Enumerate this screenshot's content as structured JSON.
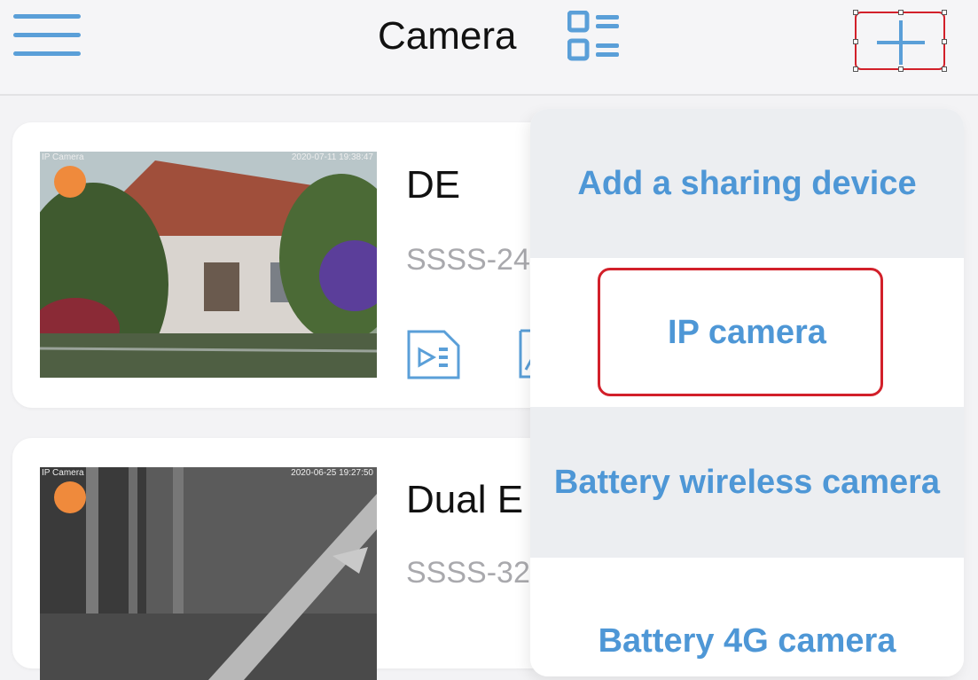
{
  "header": {
    "title": "Camera",
    "menu_icon": "hamburger-menu-icon",
    "layout_icon": "grid-list-icon",
    "add_icon": "plus-icon"
  },
  "cameras": [
    {
      "name": "DE",
      "id": "SSSS-24",
      "thumb_label": "IP Camera",
      "thumb_time": "2020-07-11 19:38:47",
      "status_color": "#ef8a3c"
    },
    {
      "name": "Dual E",
      "id": "SSSS-32",
      "thumb_label": "IP Camera",
      "thumb_time": "2020-06-25 19:27:50",
      "status_color": "#ef8a3c"
    }
  ],
  "add_menu": {
    "items": [
      {
        "label": "Add a sharing device"
      },
      {
        "label": "IP camera"
      },
      {
        "label": "Battery wireless camera"
      },
      {
        "label": "Battery 4G camera"
      }
    ]
  },
  "colors": {
    "accent": "#4e97d6",
    "highlight": "#d2202a",
    "status": "#ef8a3c"
  }
}
